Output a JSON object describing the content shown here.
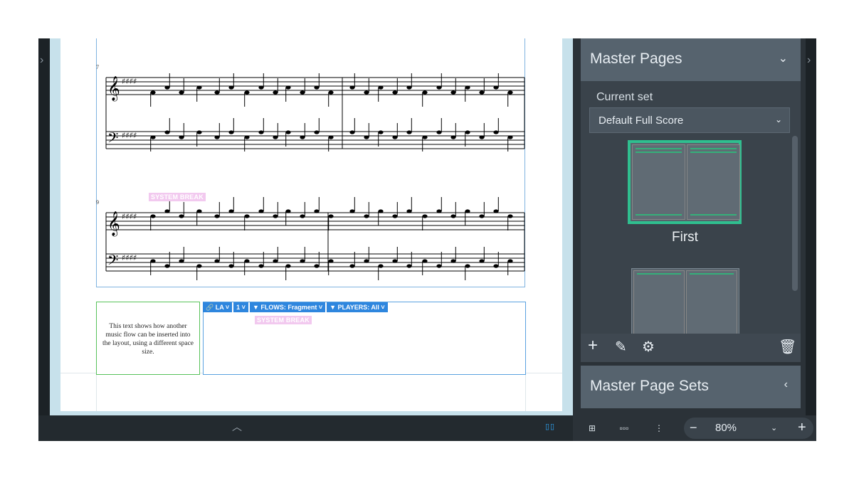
{
  "score": {
    "measure_numbers": [
      "7",
      "9"
    ],
    "system_break_tag": "SYSTEM BREAK",
    "text_frame": "This text shows how another music flow can be inserted into the layout, using a different space size.",
    "flow_frame_chips": [
      "LA",
      "1",
      "FLOWS: Fragment",
      "PLAYERS: All"
    ]
  },
  "panel": {
    "master_pages": {
      "title": "Master Pages",
      "current_set_label": "Current set",
      "current_set_value": "Default Full Score",
      "thumbnails": [
        "First"
      ]
    },
    "master_page_sets": {
      "title": "Master Page Sets"
    }
  },
  "status": {
    "zoom": "80%"
  },
  "colors": {
    "accent": "#2fbf8f",
    "frame_blue": "#5aa2e0",
    "frame_green": "#58c25a",
    "panel_header": "#56636e"
  },
  "icons": [
    "add-icon",
    "edit-icon",
    "settings-icon",
    "trash-icon",
    "chevron-down-icon",
    "chevron-left-icon",
    "chevron-right-icon",
    "chevron-up-icon",
    "zoom-out-icon",
    "zoom-in-icon"
  ]
}
